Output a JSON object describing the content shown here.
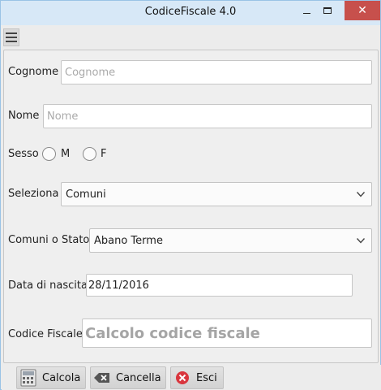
{
  "window": {
    "title": "CodiceFiscale 4.0"
  },
  "toolbar": {
    "menu_icon": "hamburger-icon"
  },
  "form": {
    "cognome": {
      "label": "Cognome",
      "placeholder": "Cognome",
      "value": ""
    },
    "nome": {
      "label": "Nome",
      "placeholder": "Nome",
      "value": ""
    },
    "sesso": {
      "label": "Sesso",
      "option_m": "M",
      "option_f": "F"
    },
    "seleziona": {
      "label": "Seleziona",
      "value": "Comuni"
    },
    "comune": {
      "label": "Comuni o Stato",
      "value": "Abano Terme"
    },
    "data_nascita": {
      "label": "Data di nascita",
      "value": "28/11/2016"
    },
    "codice_fiscale": {
      "label": "Codice Fiscale",
      "value": "Calcolo codice fiscale"
    }
  },
  "buttons": {
    "calcola": "Calcola",
    "cancella": "Cancella",
    "esci": "Esci"
  },
  "colors": {
    "titlebar": "#d7e8f7",
    "close_button": "#c7504c",
    "esci_icon": "#d9363e"
  }
}
